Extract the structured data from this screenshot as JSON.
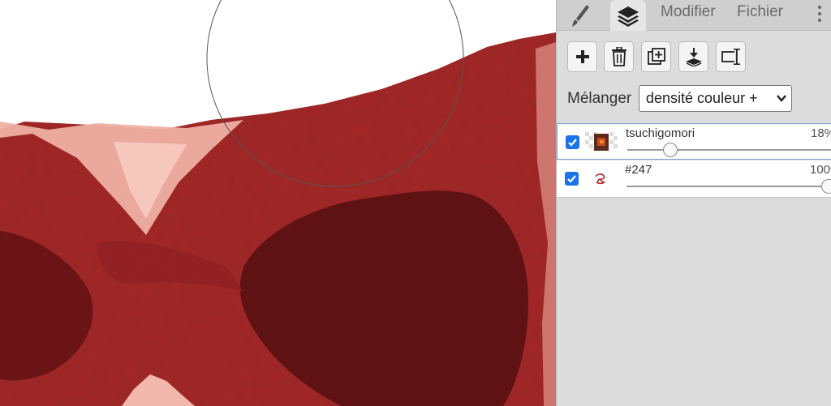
{
  "app": {
    "tabs": {
      "brush_icon": "brush-icon",
      "layers_icon": "layers-icon",
      "modifier": "Modifier",
      "fichier": "Fichier",
      "more_icon": "more-vertical-icon"
    },
    "toolbar": {
      "add_icon": "plus-icon",
      "delete_icon": "trash-icon",
      "duplicate_icon": "duplicate-icon",
      "merge_icon": "merge-down-icon",
      "rename_icon": "rename-icon"
    },
    "blend": {
      "label": "Mélanger",
      "selected": "densité couleur +"
    },
    "layers": [
      {
        "name": "tsuchigomori",
        "opacity_label": "18%",
        "opacity": 0.18,
        "visible": true,
        "selected": true
      },
      {
        "name": "#247",
        "opacity_label": "100%",
        "opacity": 1.0,
        "visible": true,
        "selected": false
      }
    ],
    "colors": {
      "panel_bg": "#dcdcdc",
      "accent": "#1a73e8",
      "paint_red": "#a5292b",
      "paint_dark": "#5e1214",
      "paint_pink": "#f0b3a8"
    }
  }
}
